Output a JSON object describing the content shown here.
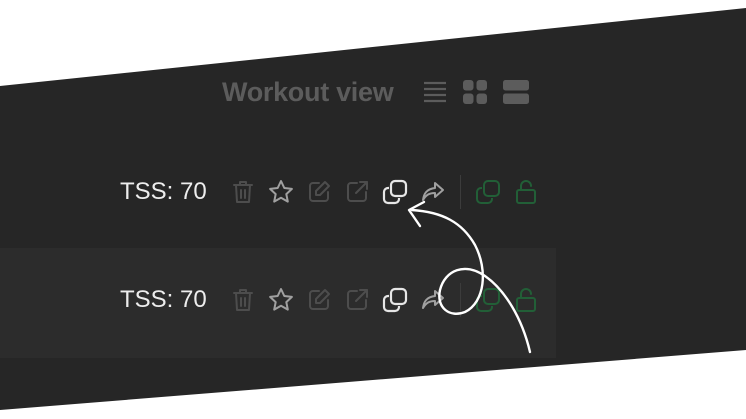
{
  "header": {
    "title": "Workout view",
    "view_options": [
      "list-view-icon",
      "grid-view-icon",
      "rows-view-icon"
    ]
  },
  "rows": [
    {
      "tss": "TSS: 70",
      "actions": [
        "trash-icon",
        "star-icon",
        "edit-icon",
        "open-external-icon",
        "copy-icon",
        "share-icon",
        "copy-locked-icon",
        "lock-icon"
      ]
    },
    {
      "tss": "TSS: 70",
      "actions": [
        "trash-icon",
        "star-icon",
        "edit-icon",
        "open-external-icon",
        "copy-icon",
        "share-icon",
        "copy-locked-icon",
        "lock-icon"
      ]
    }
  ],
  "colors": {
    "background": "#262626",
    "title": "#5c5c5c",
    "text": "#ededed",
    "accent_green": "#225f37",
    "annotation": "#ffffff"
  }
}
